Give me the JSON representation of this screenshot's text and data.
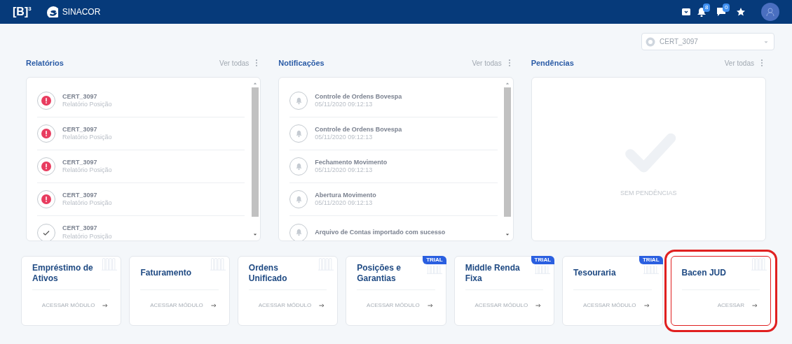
{
  "header": {
    "logo": "[B]",
    "logo_sup": "3",
    "app_name": "SINACOR",
    "badges": [
      {
        "kind": "bell",
        "count": "8"
      },
      {
        "kind": "chat",
        "count": "0"
      }
    ]
  },
  "environment_select": {
    "value": "CERT_3097"
  },
  "panels": [
    {
      "kind": "reports",
      "title": "Relatórios",
      "link": "Ver todas",
      "items": [
        {
          "title": "CERT_3097",
          "subtitle": "Relatório Posição",
          "kind": "alert"
        },
        {
          "title": "CERT_3097",
          "subtitle": "Relatório Posição",
          "kind": "alert"
        },
        {
          "title": "CERT_3097",
          "subtitle": "Relatório Posição",
          "kind": "alert"
        },
        {
          "title": "CERT_3097",
          "subtitle": "Relatório Posição",
          "kind": "alert"
        },
        {
          "title": "CERT_3097",
          "subtitle": "Relatório Posição",
          "kind": "check"
        }
      ]
    },
    {
      "kind": "notifications",
      "title": "Notificações",
      "link": "Ver todas",
      "items": [
        {
          "title": "Controle de Ordens Bovespa",
          "subtitle": "05/11/2020 09:12:13"
        },
        {
          "title": "Controle de Ordens Bovespa",
          "subtitle": "05/11/2020 09:12:13"
        },
        {
          "title": "Fechamento Movimento",
          "subtitle": "05/11/2020 09:12:13"
        },
        {
          "title": "Abertura Movimento",
          "subtitle": "05/11/2020 09:12:13"
        },
        {
          "title": "Arquivo de Contas importado com sucesso"
        }
      ]
    },
    {
      "kind": "pending",
      "title": "Pendências",
      "link": "Ver todas",
      "empty_text": "SEM PENDÊNCIAS"
    }
  ],
  "modules": [
    {
      "title": "Empréstimo de Ativos",
      "action": "ACESSAR MÓDULO",
      "trial": false,
      "highlighted": false
    },
    {
      "title": "Faturamento",
      "action": "ACESSAR MÓDULO",
      "trial": false,
      "highlighted": false
    },
    {
      "title": "Ordens Unificado",
      "action": "ACESSAR MÓDULO",
      "trial": false,
      "highlighted": false
    },
    {
      "title": "Posições e Garantias",
      "action": "ACESSAR MÓDULO",
      "trial": true,
      "trial_label": "TRIAL",
      "highlighted": false
    },
    {
      "title": "Middle Renda Fixa",
      "action": "ACESSAR MÓDULO",
      "trial": true,
      "trial_label": "TRIAL",
      "highlighted": false
    },
    {
      "title": "Tesouraria",
      "action": "ACESSAR MÓDULO",
      "trial": true,
      "trial_label": "TRIAL",
      "highlighted": false
    },
    {
      "title": "Bacen JUD",
      "action": "ACESSAR",
      "trial": false,
      "highlighted": true
    }
  ]
}
